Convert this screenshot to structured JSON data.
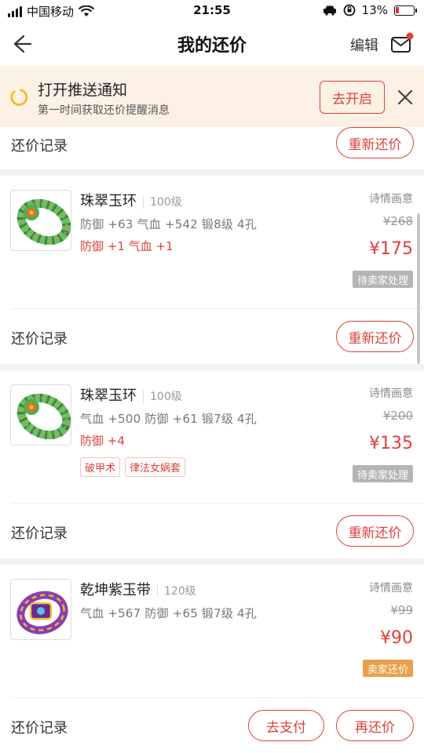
{
  "status_bar": {
    "carrier": "中国移动",
    "time": "21:55",
    "battery": "13%"
  },
  "nav": {
    "title": "我的还价",
    "edit": "编辑"
  },
  "notice": {
    "title": "打开推送通知",
    "subtitle": "第一时间获取还价提醒消息",
    "button": "去开启"
  },
  "top_record": {
    "label": "还价记录",
    "button": "重新还价"
  },
  "items": [
    {
      "name": "珠翠玉环",
      "level": "100级",
      "attrs": "防御 +63 气血 +542  锻8级  4孔",
      "extra": "防御 +1 气血 +1",
      "tags": [],
      "seller": "诗情画意",
      "original_price": "¥268",
      "offer_price": "¥175",
      "status": "待卖家处理",
      "status_color": "#b5b5b5",
      "record_label": "还价记录",
      "buttons": [
        "重新还价"
      ]
    },
    {
      "name": "珠翠玉环",
      "level": "100级",
      "attrs": "气血 +500 防御 +61  锻7级  4孔",
      "extra": "防御 +4",
      "tags": [
        "破甲术",
        "律法女娲套"
      ],
      "seller": "诗情画意",
      "original_price": "¥200",
      "offer_price": "¥135",
      "status": "待卖家处理",
      "status_color": "#b5b5b5",
      "record_label": "还价记录",
      "buttons": [
        "重新还价"
      ]
    },
    {
      "name": "乾坤紫玉带",
      "level": "120级",
      "attrs": "气血 +567 防御 +65  锻7级  4孔",
      "extra": "",
      "tags": [],
      "seller": "诗情画意",
      "original_price": "¥99",
      "offer_price": "¥90",
      "status": "卖家还价",
      "status_color": "#e8a04a",
      "record_label": "还价记录",
      "buttons": [
        "去支付",
        "再还价"
      ]
    }
  ],
  "colors": {
    "accent": "#e0403a",
    "notice_bg": "#fdf1e6",
    "counter_tag": "#e8a04a"
  },
  "icons": {
    "back": "back-arrow-icon",
    "mail": "mail-icon",
    "notify": "notification-ring-icon",
    "close": "close-icon",
    "wifi": "wifi-icon",
    "signal": "signal-icon",
    "battery": "battery-icon"
  }
}
